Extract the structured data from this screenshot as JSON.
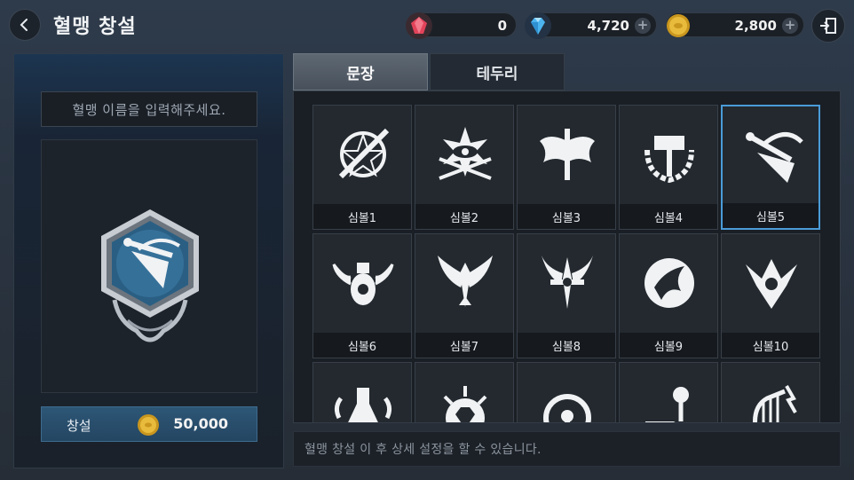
{
  "header": {
    "title": "혈맹 창설",
    "currencies": [
      {
        "icon": "red-gem-icon",
        "value": "0",
        "has_plus": false
      },
      {
        "icon": "blue-diamond-icon",
        "value": "4,720",
        "has_plus": true
      },
      {
        "icon": "gold-coin-icon",
        "value": "2,800",
        "has_plus": true
      }
    ]
  },
  "left": {
    "name_placeholder": "혈맹 이름을 입력해주세요.",
    "create_label": "창설",
    "create_cost": "50,000"
  },
  "tabs": [
    {
      "label": "문장",
      "active": true
    },
    {
      "label": "테두리",
      "active": false
    }
  ],
  "symbols": [
    {
      "label": "심볼1",
      "icon": "pentagram-sword-icon"
    },
    {
      "label": "심볼2",
      "icon": "eye-swords-icon"
    },
    {
      "label": "심볼3",
      "icon": "dragon-wings-icon"
    },
    {
      "label": "심볼4",
      "icon": "hammer-laurel-icon"
    },
    {
      "label": "심볼5",
      "icon": "winged-shield-icon",
      "selected": true
    },
    {
      "label": "심볼6",
      "icon": "vase-wings-icon"
    },
    {
      "label": "심볼7",
      "icon": "eagle-icon"
    },
    {
      "label": "심볼8",
      "icon": "winged-cross-icon"
    },
    {
      "label": "심볼9",
      "icon": "phoenix-circle-icon"
    },
    {
      "label": "심볼10",
      "icon": "tribal-crest-icon"
    },
    {
      "label": "",
      "icon": "flask-icon"
    },
    {
      "label": "",
      "icon": "sun-gem-icon"
    },
    {
      "label": "",
      "icon": "ornate-circle-icon"
    },
    {
      "label": "",
      "icon": "mace-boot-icon"
    },
    {
      "label": "",
      "icon": "harp-icon"
    }
  ],
  "hint": "혈맹 창설 이 후 상세 설정을 할 수 있습니다.",
  "colors": {
    "accent_blue": "#4a9bd8",
    "button_blue": "#2d5676",
    "gold": "#d4a72c"
  }
}
